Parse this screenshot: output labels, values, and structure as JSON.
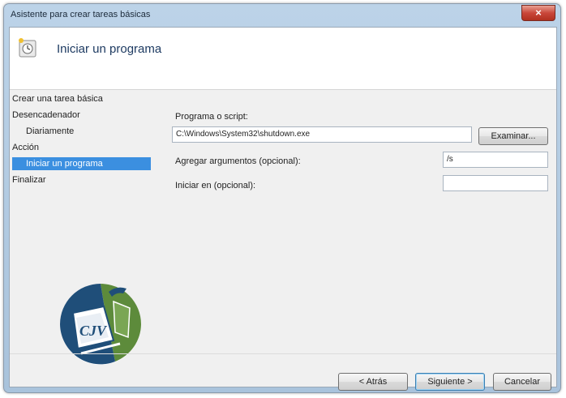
{
  "window": {
    "title": "Asistente para crear tareas básicas",
    "close_symbol": "×"
  },
  "header": {
    "title": "Iniciar un programa",
    "icon": "task-scheduler-icon"
  },
  "nav": {
    "items": [
      {
        "label": "Crear una tarea básica"
      },
      {
        "label": "Desencadenador"
      },
      {
        "label": "Diariamente"
      },
      {
        "label": "Acción"
      },
      {
        "label": "Iniciar un programa"
      },
      {
        "label": "Finalizar"
      }
    ]
  },
  "form": {
    "program_label": "Programa o script:",
    "program_value": "C:\\Windows\\System32\\shutdown.exe",
    "browse_label": "Examinar...",
    "args_label": "Agregar argumentos (opcional):",
    "args_value": "/s",
    "start_in_label": "Iniciar en (opcional):",
    "start_in_value": ""
  },
  "buttons": {
    "back": "< Atrás",
    "next": "Siguiente >",
    "cancel": "Cancelar"
  },
  "colors": {
    "selection": "#3b8fe0",
    "logo_blue": "#1f4e79",
    "logo_green": "#5d8b3b"
  }
}
